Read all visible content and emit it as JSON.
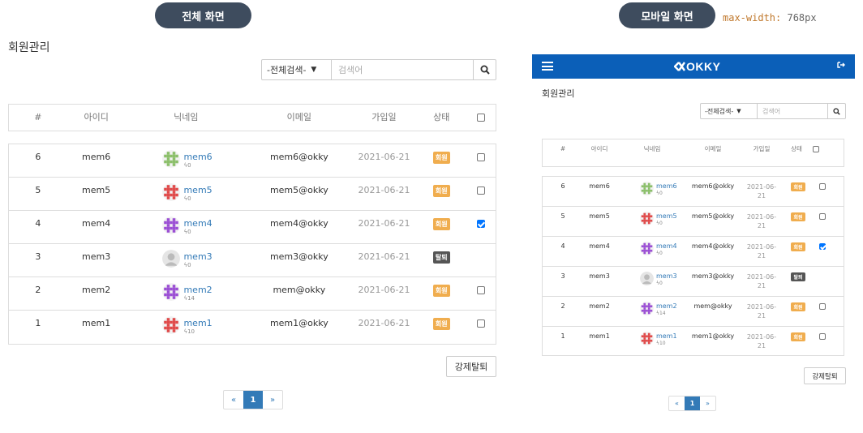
{
  "labels": {
    "full_view": "전체 화면",
    "mobile_view": "모바일 화면",
    "css_prop": "max-width:",
    "css_value": "768px"
  },
  "page_title": "회원관리",
  "brand": {
    "name": "OKKY",
    "nav_color": "#0b5fb8"
  },
  "search": {
    "select_value": "-전체검색-",
    "placeholder": "검색어",
    "button_icon": "search-icon"
  },
  "table": {
    "headers": [
      "#",
      "아이디",
      "닉네임",
      "이메일",
      "가입일",
      "상태"
    ],
    "rows": [
      {
        "num": "6",
        "id": "mem6",
        "nick": "mem6",
        "pts": "0",
        "email": "mem6@okky",
        "date": "2021-06-21",
        "status": "회원",
        "status_type": "member",
        "checked": false,
        "avatar_color": "#8bbf6a"
      },
      {
        "num": "5",
        "id": "mem5",
        "nick": "mem5",
        "pts": "0",
        "email": "mem5@okky",
        "date": "2021-06-21",
        "status": "회원",
        "status_type": "member",
        "checked": false,
        "avatar_color": "#e04a4a"
      },
      {
        "num": "4",
        "id": "mem4",
        "nick": "mem4",
        "pts": "0",
        "email": "mem4@okky",
        "date": "2021-06-21",
        "status": "회원",
        "status_type": "member",
        "checked": true,
        "avatar_color": "#9b4fd4"
      },
      {
        "num": "3",
        "id": "mem3",
        "nick": "mem3",
        "pts": "0",
        "email": "mem3@okky",
        "date": "2021-06-21",
        "status": "탈퇴",
        "status_type": "left",
        "checked": null,
        "avatar_color": "#bbbbbb"
      },
      {
        "num": "2",
        "id": "mem2",
        "nick": "mem2",
        "pts": "14",
        "email": "mem@okky",
        "date": "2021-06-21",
        "status": "회원",
        "status_type": "member",
        "checked": false,
        "avatar_color": "#9b4fd4"
      },
      {
        "num": "1",
        "id": "mem1",
        "nick": "mem1",
        "pts": "10",
        "email": "mem1@okky",
        "date": "2021-06-21",
        "status": "회원",
        "status_type": "member",
        "checked": false,
        "avatar_color": "#e04a4a"
      }
    ]
  },
  "mobile_dates": {
    "line1": "2021-06-",
    "line2": "21"
  },
  "actions": {
    "force_withdraw": "강제탈퇴"
  },
  "pagination": {
    "prev": "«",
    "current": "1",
    "next": "»"
  }
}
